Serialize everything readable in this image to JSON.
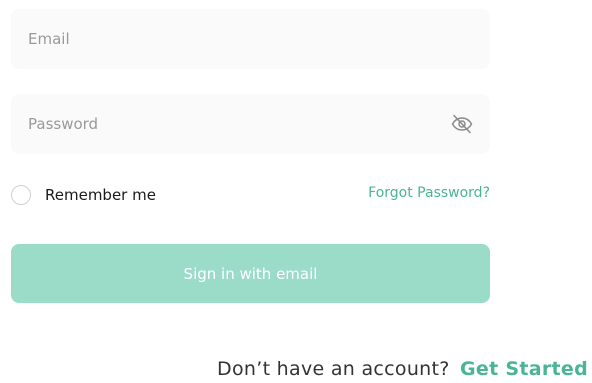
{
  "form": {
    "email": {
      "placeholder": "Email",
      "value": ""
    },
    "password": {
      "placeholder": "Password",
      "value": "",
      "toggle_icon": "eye-off-icon"
    },
    "remember": {
      "label": "Remember me",
      "checked": false
    },
    "forgot_label": "Forgot Password?",
    "submit_label": "Sign in with email"
  },
  "footer": {
    "prompt": "Don’t have an account?",
    "cta": "Get Started"
  },
  "colors": {
    "accent": "#49b596",
    "button_bg": "#9bdcc8",
    "field_bg": "#fafafa",
    "placeholder": "#9a9a9a"
  }
}
